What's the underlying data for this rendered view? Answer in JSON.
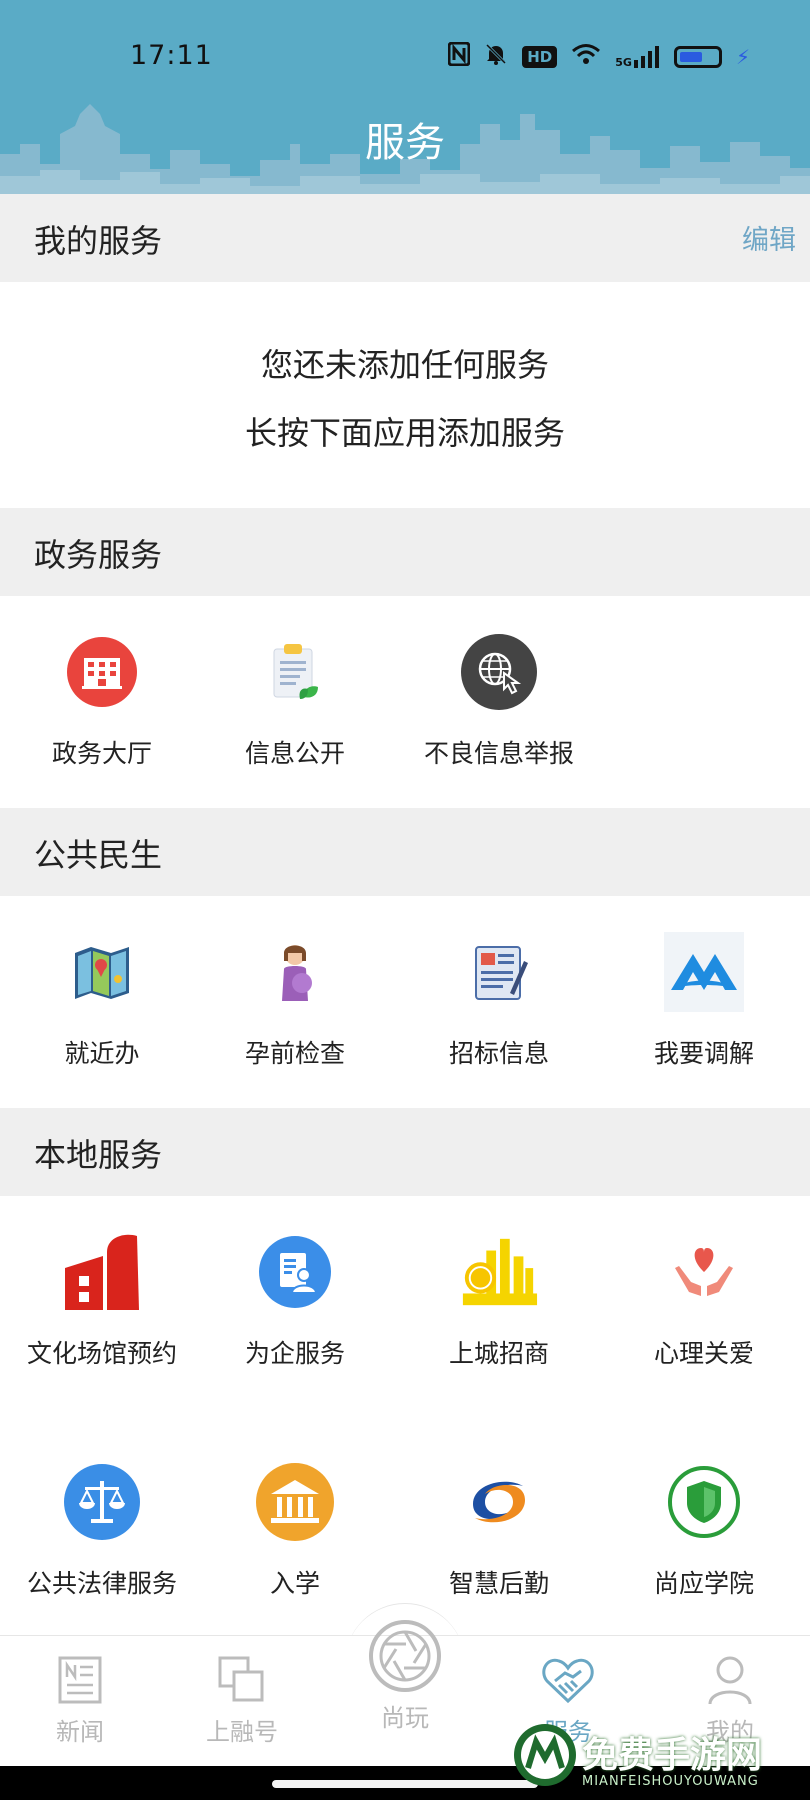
{
  "status_bar": {
    "time": "17:11",
    "icons": [
      "nfc-icon",
      "mute-icon",
      "hd-icon",
      "wifi-icon",
      "5g-signal-icon",
      "battery-icon",
      "charging-icon"
    ],
    "hd": "HD",
    "signal": "5G"
  },
  "header": {
    "title": "服务",
    "bg_color": "#5aabc6"
  },
  "my_services": {
    "title": "我的服务",
    "edit": "编辑",
    "empty_line1": "您还未添加任何服务",
    "empty_line2": "长按下面应用添加服务"
  },
  "gov_services": {
    "title": "政务服务",
    "items": [
      {
        "label": "政务大厅",
        "icon": "building-icon"
      },
      {
        "label": "信息公开",
        "icon": "clipboard-icon"
      },
      {
        "label": "不良信息举报",
        "icon": "globe-touch-icon"
      }
    ]
  },
  "public_services": {
    "title": "公共民生",
    "items": [
      {
        "label": "就近办",
        "icon": "map-icon"
      },
      {
        "label": "孕前检查",
        "icon": "pregnant-woman-icon"
      },
      {
        "label": "招标信息",
        "icon": "document-pen-icon"
      },
      {
        "label": "我要调解",
        "icon": "mediation-logo-icon"
      }
    ]
  },
  "local_services": {
    "title": "本地服务",
    "items": [
      {
        "label": "文化场馆预约",
        "icon": "venue-icon"
      },
      {
        "label": "为企服务",
        "icon": "enterprise-icon"
      },
      {
        "label": "上城招商",
        "icon": "city-coins-icon"
      },
      {
        "label": "心理关爱",
        "icon": "heart-hands-icon"
      },
      {
        "label": "公共法律服务",
        "icon": "scales-icon"
      },
      {
        "label": "入学",
        "icon": "school-icon"
      },
      {
        "label": "智慧后勤",
        "icon": "swirl-logo-icon"
      },
      {
        "label": "尚应学院",
        "icon": "shield-icon"
      }
    ]
  },
  "bottom_nav": [
    {
      "label": "新闻",
      "icon": "news-icon",
      "active": false
    },
    {
      "label": "上融号",
      "icon": "squares-icon",
      "active": false
    },
    {
      "label": "尚玩",
      "icon": "camera-aperture-icon",
      "active": false
    },
    {
      "label": "服务",
      "icon": "handshake-icon",
      "active": true
    },
    {
      "label": "我的",
      "icon": "person-icon",
      "active": false
    }
  ],
  "watermark": {
    "title": "免费手游网",
    "subtitle": "MIANFEISHOUYOUWANG"
  }
}
